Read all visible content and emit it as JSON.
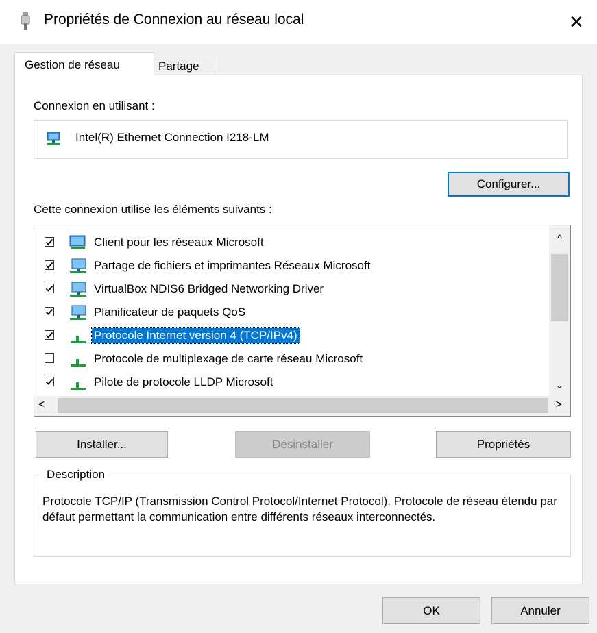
{
  "window": {
    "title": "Propriétés de Connexion au réseau local",
    "close_glyph": "✕"
  },
  "tabs": [
    {
      "label": "Gestion de réseau"
    },
    {
      "label": "Partage"
    }
  ],
  "connect_using": {
    "label": "Connexion en utilisant :",
    "adapter": "Intel(R) Ethernet Connection I218-LM",
    "adapter_icon": "network-adapter-icon"
  },
  "configure_button": "Configurer...",
  "items_label": "Cette connexion utilise les éléments suivants :",
  "items": [
    {
      "label": "Client pour les réseaux Microsoft",
      "checked": true,
      "icon": "network-client-icon",
      "selected": false
    },
    {
      "label": "Partage de fichiers et imprimantes Réseaux Microsoft",
      "checked": true,
      "icon": "network-service-icon",
      "selected": false
    },
    {
      "label": "VirtualBox NDIS6 Bridged Networking Driver",
      "checked": true,
      "icon": "network-service-icon",
      "selected": false
    },
    {
      "label": "Planificateur de paquets QoS",
      "checked": true,
      "icon": "network-service-icon",
      "selected": false
    },
    {
      "label": "Protocole Internet version 4 (TCP/IPv4)",
      "checked": true,
      "icon": "protocol-icon",
      "selected": true
    },
    {
      "label": "Protocole de multiplexage de carte réseau Microsoft",
      "checked": false,
      "icon": "protocol-icon",
      "selected": false
    },
    {
      "label": "Pilote de protocole LLDP Microsoft",
      "checked": true,
      "icon": "protocol-icon",
      "selected": false
    }
  ],
  "buttons": {
    "install": "Installer...",
    "uninstall": "Désinstaller",
    "properties": "Propriétés",
    "ok": "OK",
    "cancel": "Annuler"
  },
  "description": {
    "legend": "Description",
    "text": "Protocole TCP/IP (Transmission Control Protocol/Internet Protocol). Protocole de réseau étendu par défaut permettant la communication entre différents réseaux interconnectés."
  }
}
